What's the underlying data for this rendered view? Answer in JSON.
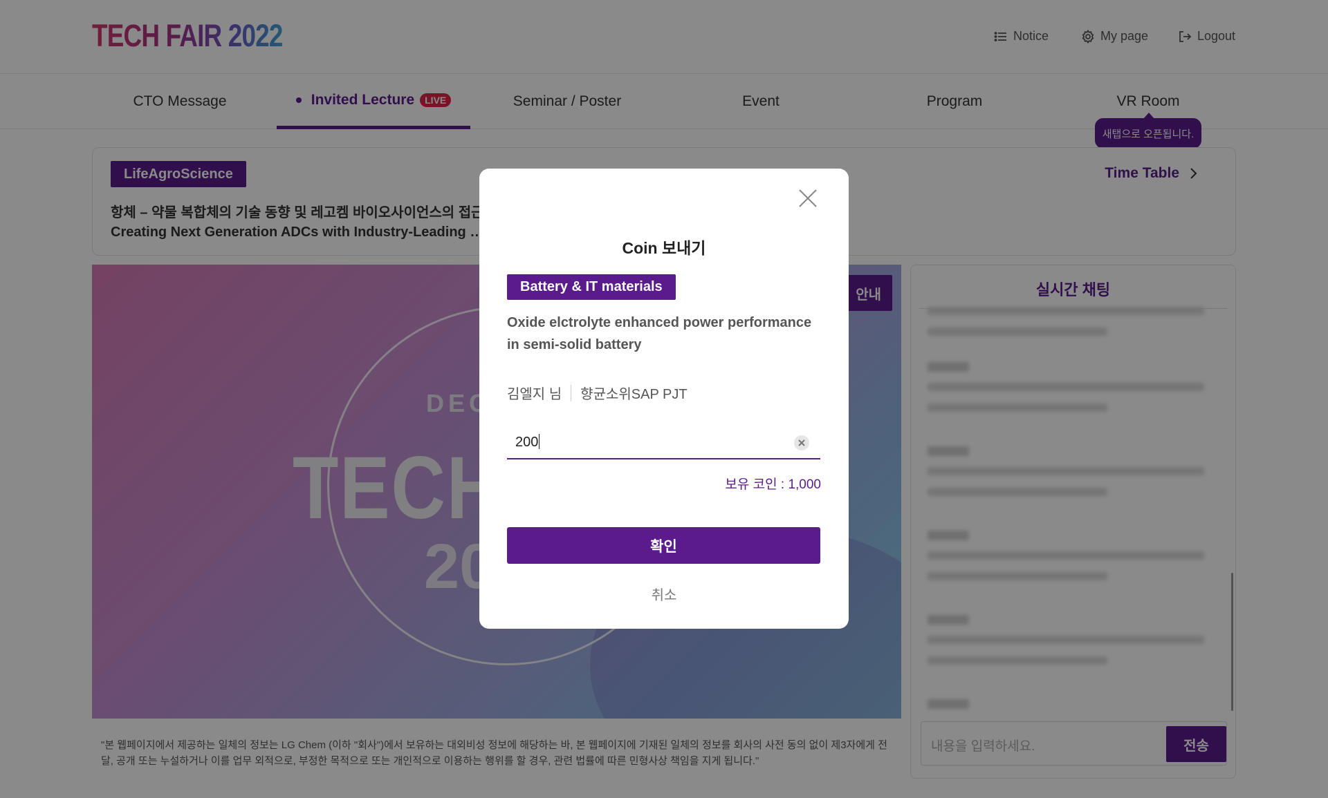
{
  "header": {
    "logo": "TECH FAIR 2022",
    "notice_label": "Notice",
    "mypage_label": "My page",
    "logout_label": "Logout"
  },
  "nav": {
    "tabs": [
      {
        "label": "CTO Message"
      },
      {
        "label": "Invited Lecture",
        "badge": "LIVE",
        "active": true
      },
      {
        "label": "Seminar / Poster"
      },
      {
        "label": "Event"
      },
      {
        "label": "Program"
      },
      {
        "label": "VR Room"
      }
    ],
    "tooltip": "새탭으로 오픈됩니다."
  },
  "session": {
    "category": "LifeAgroScience",
    "timetable_label": "Time Table",
    "title_ko": "항체 – 약물 복합체의 기술 동향 및 레고켐 바이오사이언스의 접근",
    "title_en": "Creating Next Generation ADCs with Industry-Leading … e Linker Payload Activation"
  },
  "video": {
    "dec": "DEC",
    "big": "TECH",
    "year": "20",
    "notice_button": "안내"
  },
  "disclaimer": "\"본 웹페이지에서 제공하는 일체의 정보는 LG Chem (이하 \"회사\")에서 보유하는 대외비성 정보에 해당하는 바, 본 웹페이지에 기재된 일체의 정보를 회사의 사전 동의 없이 제3자에게 전달, 공개 또는 누설하거나 이를 업무 외적으로, 부정한 목적으로 또는 개인적으로 이용하는 행위를 할 경우, 관련 법률에 따른 민형사상 책임을 지게 됩니다.\"",
  "chat": {
    "title": "실시간 채팅",
    "input_placeholder": "내용을 입력하세요.",
    "send_label": "전송"
  },
  "modal": {
    "title": "Coin 보내기",
    "tag": "Battery & IT materials",
    "subtitle": "Oxide elctrolyte enhanced power performance in semi-solid battery",
    "presenter_name": "김엘지 님",
    "presenter_team": "향균소위SAP PJT",
    "amount_value": "200",
    "coin_balance": "보유 코인 : 1,000",
    "confirm_label": "확인",
    "cancel_label": "취소"
  },
  "colors": {
    "brand_purple": "#5a1c8c",
    "live_red": "#e0264a"
  }
}
